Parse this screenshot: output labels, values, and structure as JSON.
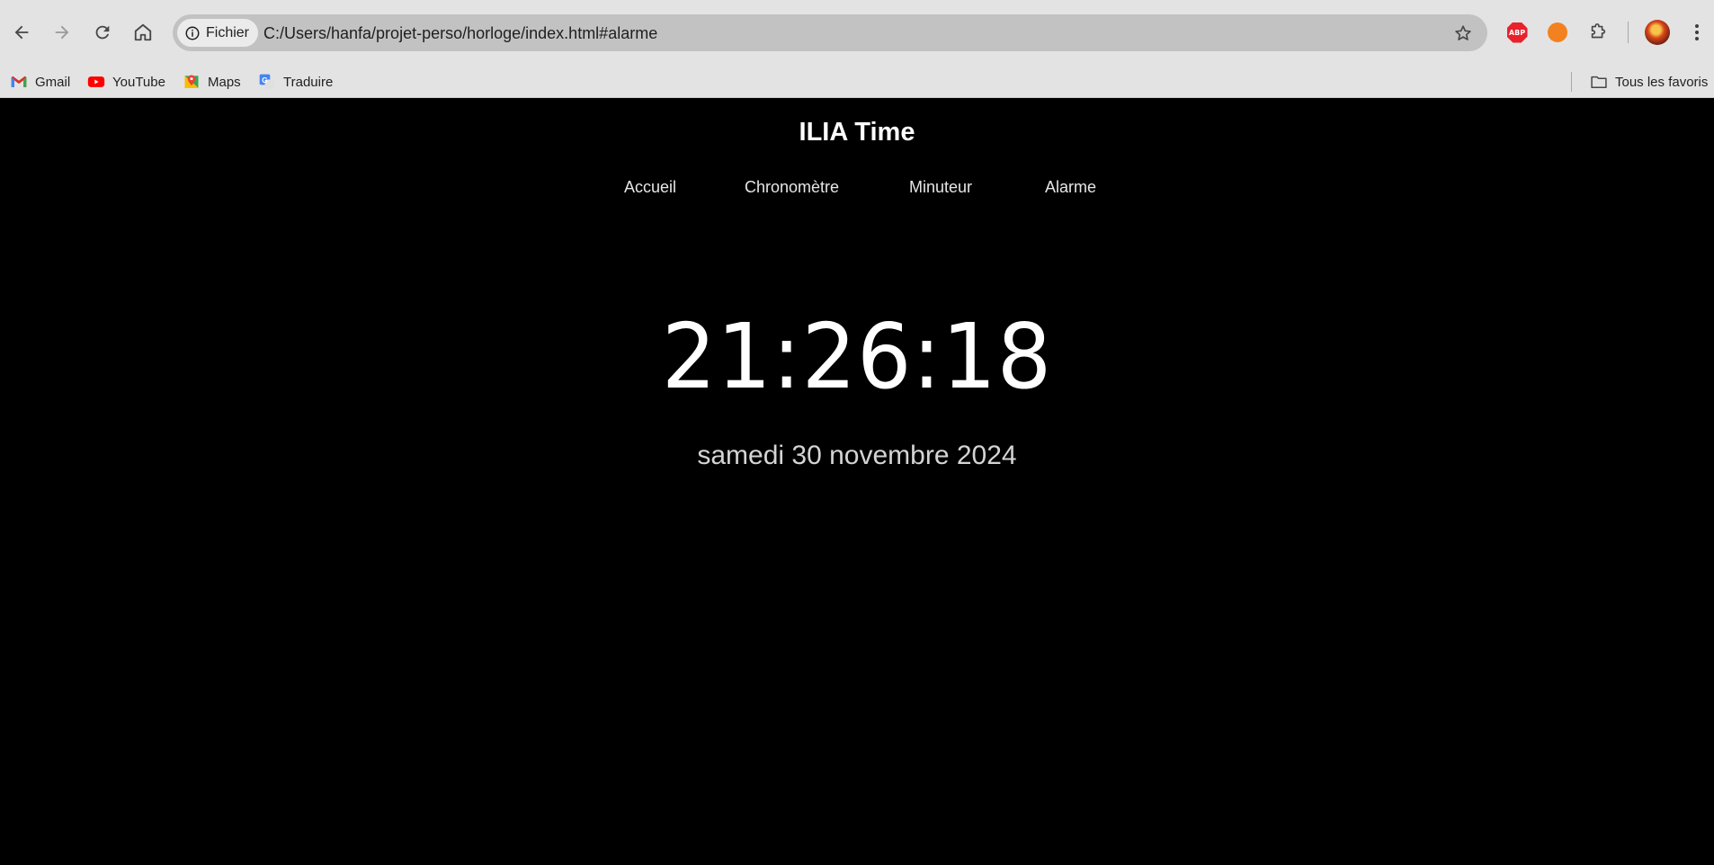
{
  "browser": {
    "site_chip_label": "Fichier",
    "url": "C:/Users/hanfa/projet-perso/horloge/index.html#alarme",
    "extensions": [
      {
        "name": "adblock-plus",
        "label": "ABP"
      },
      {
        "name": "orange-extension",
        "label": ""
      }
    ],
    "bookmarks": [
      {
        "label": "Gmail",
        "icon": "gmail-icon"
      },
      {
        "label": "YouTube",
        "icon": "youtube-icon"
      },
      {
        "label": "Maps",
        "icon": "maps-icon"
      },
      {
        "label": "Traduire",
        "icon": "translate-icon"
      }
    ],
    "all_bookmarks_label": "Tous les favoris"
  },
  "page": {
    "title": "ILIA Time",
    "nav": [
      "Accueil",
      "Chronomètre",
      "Minuteur",
      "Alarme"
    ],
    "time": "21:26:18",
    "date": "samedi 30 novembre 2024"
  },
  "colors": {
    "background": "#000000",
    "chrome": "#e3e3e3",
    "omnibox": "#c2c2c2",
    "text": "#ffffff"
  }
}
